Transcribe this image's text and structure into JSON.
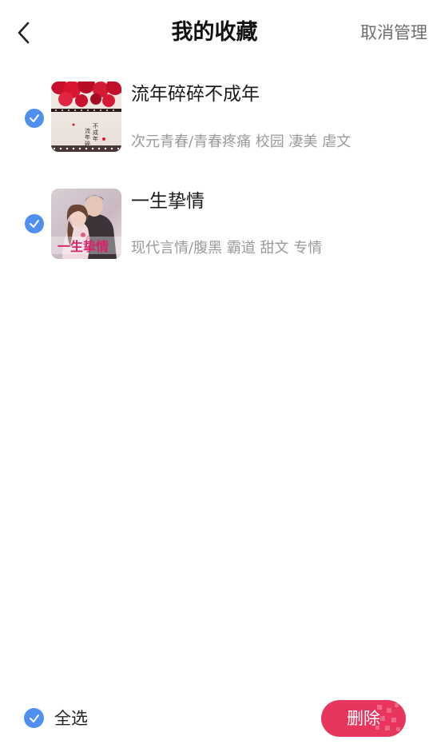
{
  "header": {
    "title": "我的收藏",
    "cancel_manage_label": "取消管理"
  },
  "books": [
    {
      "title": "流年碎碎不成年",
      "tags": "次元青春/青春疼痛 校园 凄美 虐文",
      "cover_text": "流年碎碎不成年",
      "checked": true
    },
    {
      "title": "一生挚情",
      "tags": "现代言情/腹黑 霸道 甜文 专情",
      "cover_text": "一生挚情",
      "checked": true
    }
  ],
  "footer": {
    "select_all_label": "全选",
    "delete_label": "删除"
  },
  "colors": {
    "accent_blue": "#4f8ff0",
    "delete_red": "#e8355d"
  },
  "icons": {
    "back": "chevron-left-icon",
    "check": "checkmark-icon"
  }
}
